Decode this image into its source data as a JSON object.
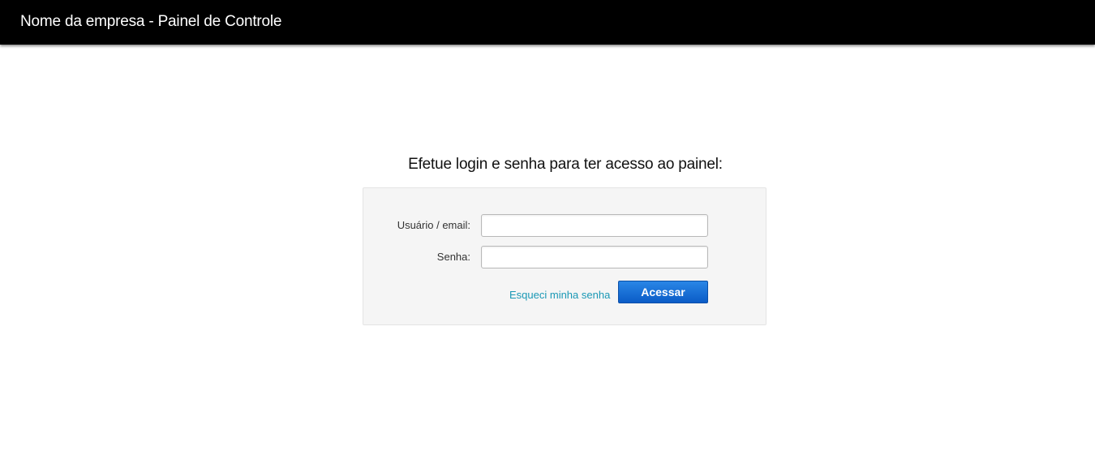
{
  "header": {
    "title": "Nome da empresa - Painel de Controle"
  },
  "login": {
    "heading": "Efetue login e senha para ter acesso ao painel:",
    "username_label": "Usuário / email:",
    "username_value": "",
    "password_label": "Senha:",
    "password_value": "",
    "forgot_link": "Esqueci minha senha",
    "submit_label": "Acessar"
  },
  "colors": {
    "header_bg": "#000000",
    "panel_bg": "#f5f5f5",
    "link": "#1a98b5",
    "button": "#0a5cc7"
  }
}
